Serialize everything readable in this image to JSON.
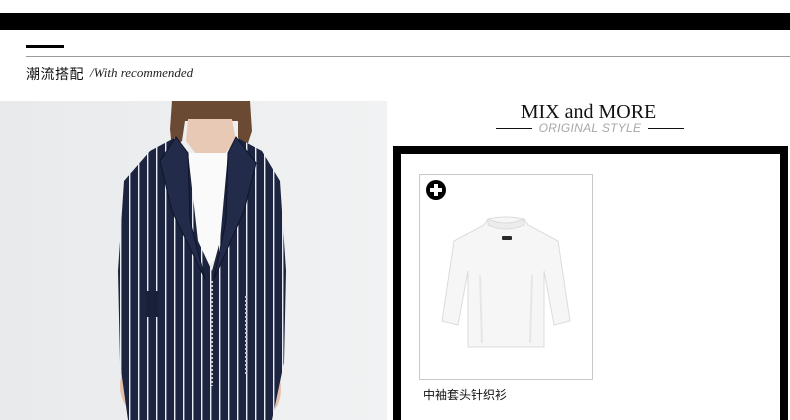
{
  "section": {
    "title": "潮流搭配",
    "subtitle": "/With recommended"
  },
  "mix": {
    "title": "MIX and MORE",
    "subtitle": "ORIGINAL STYLE"
  },
  "product": {
    "name": "中袖套头针织衫",
    "add_icon": "plus-circle-icon"
  },
  "colors": {
    "accent": "#000000",
    "muted": "#a8a8a8",
    "jacket": "#1d2440"
  }
}
